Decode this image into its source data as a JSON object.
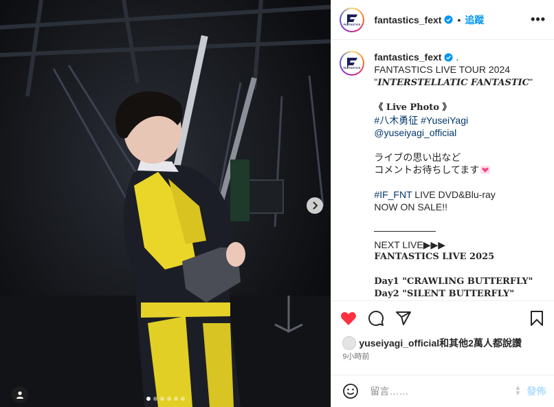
{
  "header": {
    "username": "fantastics_fext",
    "separator": "•",
    "follow_label": "追蹤",
    "more_label": "•••",
    "logo_text": "FANTASTICS"
  },
  "caption": {
    "username": "fantastics_fext",
    "after_username": " .",
    "lines": {
      "l1": "FANTASTICS LIVE TOUR 2024",
      "l2_q1": "\"",
      "l2_title": "INTERSTELLATIC FANTASTIC",
      "l2_q2": "\"",
      "l4": "《 Live Photo 》",
      "l5_tag1": "#八木勇征",
      "l5_tag2": "#YuseiYagi",
      "l6": "@yuseiyagi_official",
      "l8": "ライブの思い出など",
      "l9": "コメントお待ちしてます",
      "l11_tag": "#IF_FNT",
      "l11_text": " LIVE DVD&Blu-ray",
      "l12": "NOW ON SALE!!",
      "l14": "NEXT LIVE▶▶▶",
      "l15": "FANTASTICS LIVE 2025",
      "l17": "Day1 \"CRAWLING BUTTERFLY\"",
      "l18": "Day2 \"SILENT BUTTERFLY\""
    }
  },
  "likes": {
    "text": "yuseiyagi_official和其他2萬人都說讚"
  },
  "time": "9小時前",
  "comment": {
    "placeholder": "留言……",
    "post_label": "發佈"
  },
  "carousel": {
    "slide_count": 6,
    "active_index": 0
  },
  "colors": {
    "like_red": "#ff3040",
    "follow_blue": "#0095f6",
    "tag_blue": "#00376b",
    "verified_blue": "#0095f6"
  },
  "icons": [
    "heart-icon",
    "comment-icon",
    "share-icon",
    "bookmark-icon",
    "emoji-icon",
    "chevron-right-icon",
    "user-tag-icon",
    "verified-icon",
    "more-icon"
  ]
}
